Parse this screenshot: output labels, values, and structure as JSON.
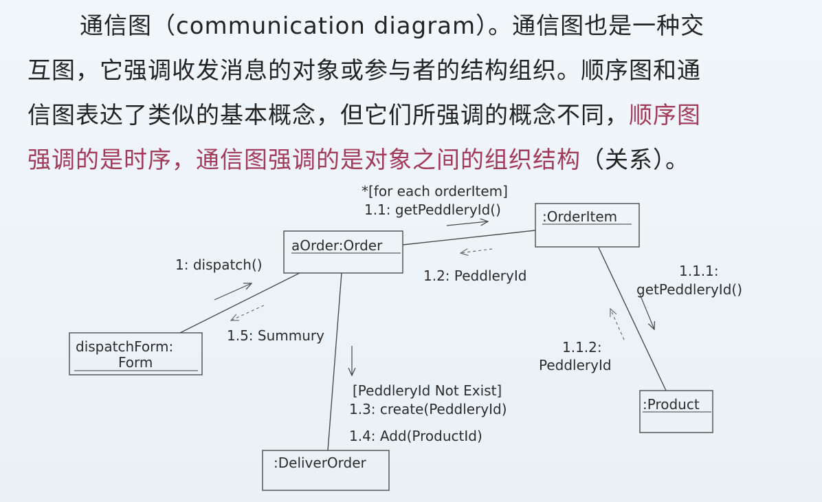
{
  "paragraph": {
    "line1": "通信图（communication diagram）。通信图也是一种交",
    "line2": "互图，它强调收发消息的对象或参与者的结构组织。顺序图和通",
    "line3_normal": "信图表达了类似的基本概念，但它们所强调的概念不同，",
    "line3_highlight": "顺序图",
    "line4_highlight": "强调的是时序，通信图强调的是对象之间的组织结构",
    "line4_end": "（关系）。"
  },
  "colors": {
    "text": "#232323",
    "highlight": "#a23a5a",
    "background": "#eef4f8",
    "lines": "#4a4a4a"
  },
  "diagram": {
    "objects": {
      "order": "aOrder:Order",
      "order_item": ":OrderItem",
      "dispatch_form_line1": "dispatchForm:",
      "dispatch_form_line2": "Form",
      "product": ":Product",
      "deliver_order": ":DeliverOrder"
    },
    "messages": {
      "m1_1_guard": "*[for each orderItem]",
      "m1_1": "1.1: getPeddleryId()",
      "m1_2": "1.2: PeddleryId",
      "m1": "1: dispatch()",
      "m1_5": "1.5: Summury",
      "m1_1_1_line1": "1.1.1:",
      "m1_1_1_line2": "getPeddleryId()",
      "m1_1_2_line1": "1.1.2:",
      "m1_1_2_line2": "PeddleryId",
      "m1_3_guard": "[PeddleryId Not Exist]",
      "m1_3": "1.3: create(PeddleryId)",
      "m1_4": "1.4: Add(ProductId)"
    }
  }
}
